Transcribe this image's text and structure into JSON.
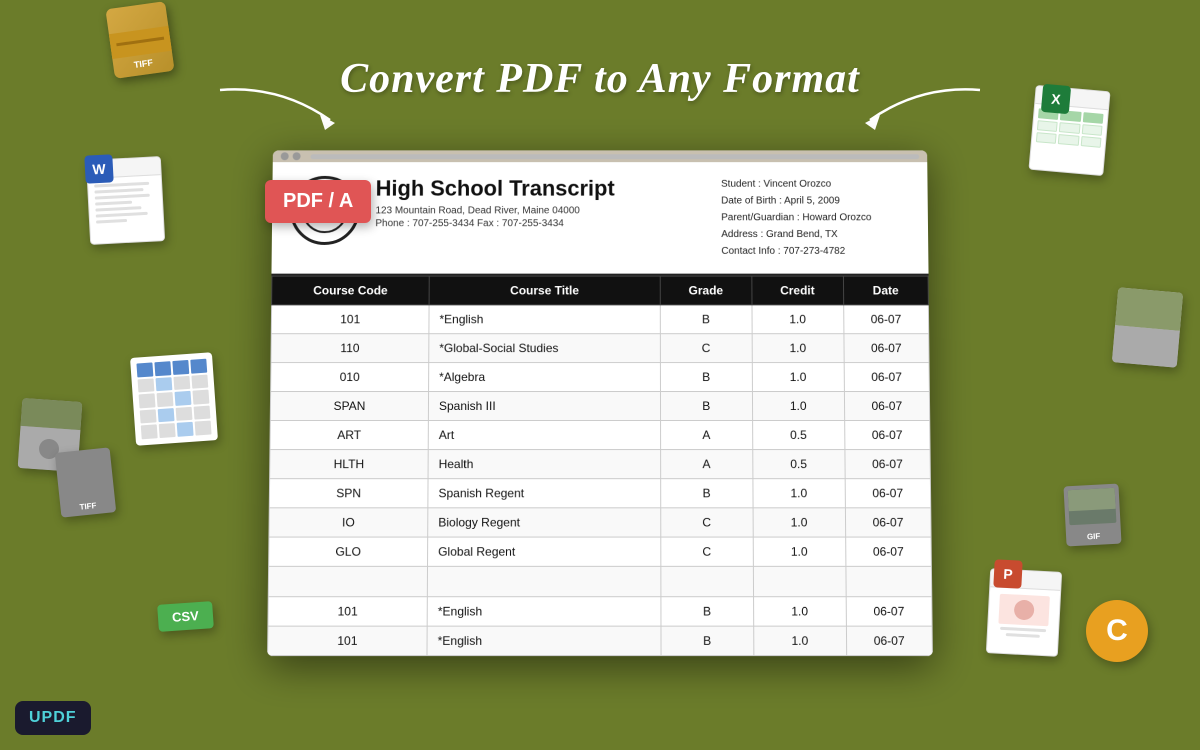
{
  "page": {
    "title": "Convert PDF to Any Format",
    "background_color": "#6b7c2a"
  },
  "updf_logo": {
    "text": "UPDF"
  },
  "pdf_badge": {
    "text": "PDF / A"
  },
  "document": {
    "logo_symbol": "📚",
    "main_title": "High School Transcript",
    "address": "123 Mountain Road, Dead River, Maine 04000",
    "phone": "Phone : 707-255-3434    Fax : 707-255-3434",
    "student_info": {
      "student": "Student : Vincent Orozco",
      "dob": "Date of Birth : April 5,  2009",
      "parent": "Parent/Guardian : Howard Orozco",
      "address": "Address : Grand Bend, TX",
      "contact": "Contact Info : 707-273-4782"
    },
    "table_headers": [
      "Course Code",
      "Course Title",
      "Grade",
      "Credit",
      "Date"
    ],
    "table_rows": [
      {
        "code": "101",
        "title": "*English",
        "grade": "B",
        "credit": "1.0",
        "date": "06-07"
      },
      {
        "code": "110",
        "title": "*Global-Social Studies",
        "grade": "C",
        "credit": "1.0",
        "date": "06-07"
      },
      {
        "code": "010",
        "title": "*Algebra",
        "grade": "B",
        "credit": "1.0",
        "date": "06-07"
      },
      {
        "code": "SPAN",
        "title": "Spanish III",
        "grade": "B",
        "credit": "1.0",
        "date": "06-07"
      },
      {
        "code": "ART",
        "title": "Art",
        "grade": "A",
        "credit": "0.5",
        "date": "06-07"
      },
      {
        "code": "HLTH",
        "title": "Health",
        "grade": "A",
        "credit": "0.5",
        "date": "06-07"
      },
      {
        "code": "SPN",
        "title": "Spanish Regent",
        "grade": "B",
        "credit": "1.0",
        "date": "06-07"
      },
      {
        "code": "IO",
        "title": "Biology Regent",
        "grade": "C",
        "credit": "1.0",
        "date": "06-07"
      },
      {
        "code": "GLO",
        "title": "Global Regent",
        "grade": "C",
        "credit": "1.0",
        "date": "06-07"
      },
      {
        "code": "",
        "title": "",
        "grade": "",
        "credit": "",
        "date": ""
      },
      {
        "code": "101",
        "title": "*English",
        "grade": "B",
        "credit": "1.0",
        "date": "06-07"
      },
      {
        "code": "101",
        "title": "*English",
        "grade": "B",
        "credit": "1.0",
        "date": "06-07"
      }
    ]
  },
  "floating_icons": {
    "tiff": "TIFF",
    "word": "W",
    "excel": "X",
    "csv": "CSV",
    "gif": "GIF",
    "powerpoint": "P",
    "c_lang": "C"
  }
}
